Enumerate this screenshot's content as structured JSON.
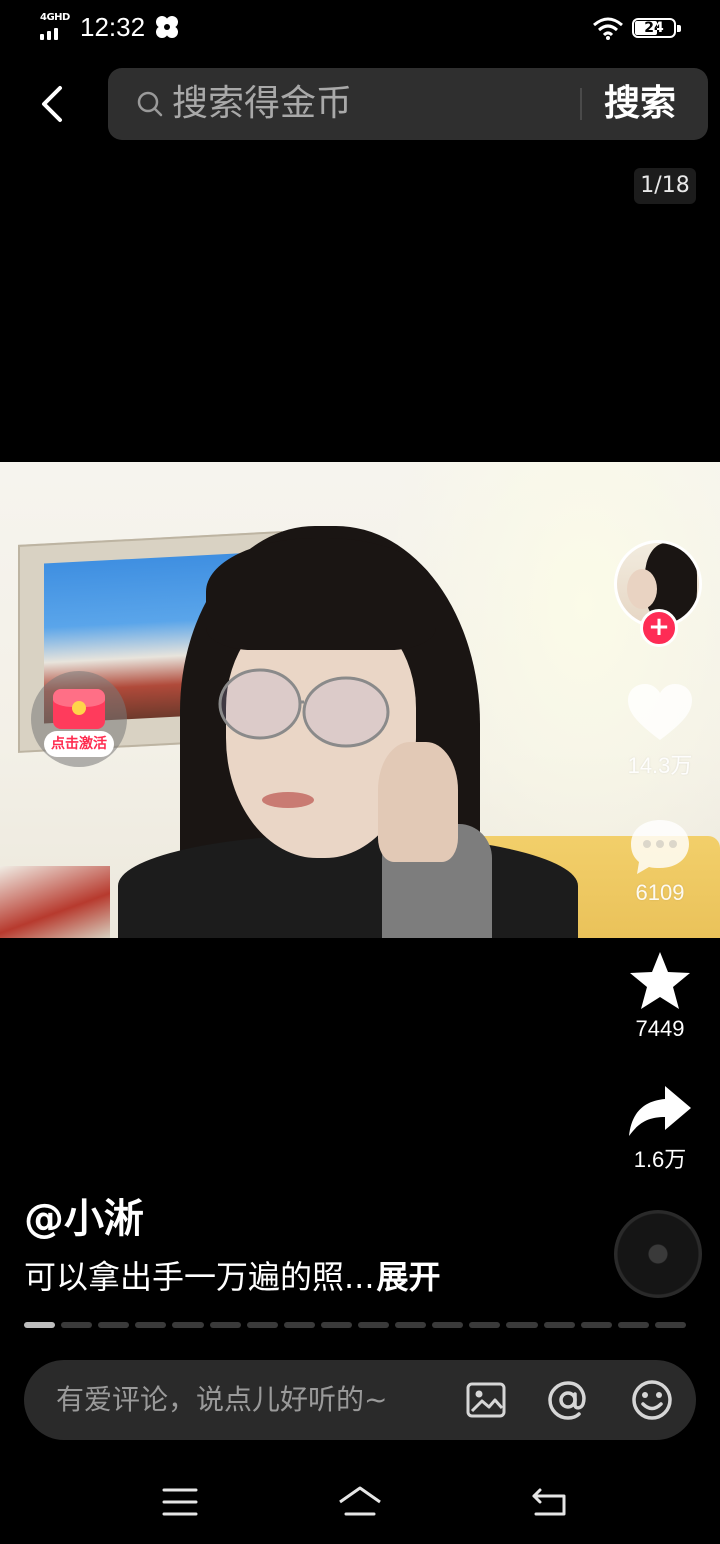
{
  "status_bar": {
    "network": "4GHD",
    "time": "12:32",
    "battery": "24"
  },
  "header": {
    "search_placeholder": "搜索得金币",
    "search_button": "搜索"
  },
  "page_counter": "1/18",
  "promo_badge": {
    "label": "点击激活"
  },
  "actions": {
    "likes": "14.3万",
    "comments": "6109",
    "favorites": "7449",
    "shares": "1.6万"
  },
  "post": {
    "author": "@小淅",
    "caption": "可以拿出手一万遍的照...",
    "expand": "展开"
  },
  "progress": {
    "segments": 18,
    "active_index": 0
  },
  "comment_bar": {
    "placeholder": "有爱评论，说点儿好听的~"
  }
}
